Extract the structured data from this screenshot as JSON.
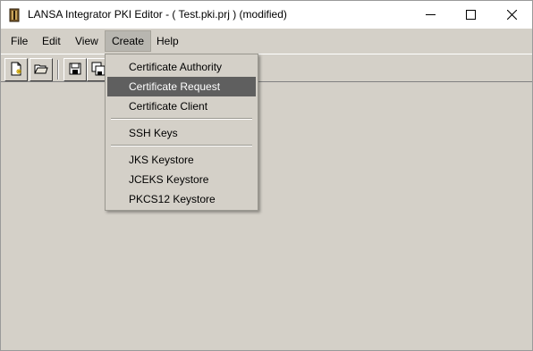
{
  "window": {
    "title": "LANSA Integrator PKI Editor - ( Test.pki.prj ) (modified)",
    "app_icon": "lansa-app-icon",
    "controls": {
      "minimize": "minimize-icon",
      "maximize": "maximize-icon",
      "close": "close-icon"
    }
  },
  "menubar": {
    "items": [
      {
        "label": "File"
      },
      {
        "label": "Edit"
      },
      {
        "label": "View"
      },
      {
        "label": "Create",
        "open": true
      },
      {
        "label": "Help"
      }
    ]
  },
  "toolbar": {
    "buttons": [
      {
        "icon": "new-document-icon"
      },
      {
        "icon": "open-folder-icon"
      },
      {
        "icon": "save-icon"
      },
      {
        "icon": "save-all-icon"
      }
    ]
  },
  "create_menu": {
    "items": [
      {
        "label": "Certificate Authority"
      },
      {
        "label": "Certificate Request",
        "highlighted": true
      },
      {
        "label": "Certificate Client"
      },
      {
        "label": "SSH Keys"
      },
      {
        "label": "JKS Keystore"
      },
      {
        "label": "JCEKS Keystore"
      },
      {
        "label": "PKCS12 Keystore"
      }
    ]
  },
  "colors": {
    "face": "#d4d0c8",
    "highlight": "#5f5f5f",
    "titlebar": "#ffffff"
  }
}
